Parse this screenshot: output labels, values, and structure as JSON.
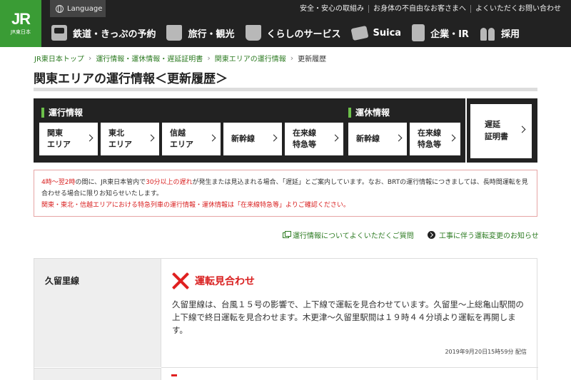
{
  "header": {
    "logo_mark": "JR",
    "logo_text": "JR東日本",
    "language_label": "Language",
    "top_links": [
      "安全・安心の取組み",
      "お身体の不自由なお客さまへ",
      "よくいただくお問い合わせ"
    ],
    "nav": [
      {
        "label": "鉄道・きっぷの予約",
        "icon": "train-icon"
      },
      {
        "label": "旅行・観光",
        "icon": "suitcase-icon"
      },
      {
        "label": "くらしのサービス",
        "icon": "shopping-bag-icon"
      },
      {
        "label": "Suica",
        "icon": "card-icon"
      },
      {
        "label": "企業・IR",
        "icon": "building-icon"
      },
      {
        "label": "採用",
        "icon": "people-icon"
      }
    ]
  },
  "breadcrumb": [
    "JR東日本トップ",
    "運行情報・運休情報・遅延証明書",
    "関東エリアの運行情報",
    "更新履歴"
  ],
  "page_title": "関東エリアの運行情報＜更新履歴＞",
  "ops_panel": {
    "operation_heading": "運行情報",
    "suspension_heading": "運休情報",
    "operation_buttons": [
      {
        "line1": "関東",
        "line2": "エリア"
      },
      {
        "line1": "東北",
        "line2": "エリア"
      },
      {
        "line1": "信越",
        "line2": "エリア"
      },
      {
        "line1": "新幹線",
        "line2": ""
      },
      {
        "line1": "在来線",
        "line2": "特急等"
      }
    ],
    "suspension_buttons": [
      {
        "line1": "新幹線",
        "line2": ""
      },
      {
        "line1": "在来線",
        "line2": "特急等"
      }
    ],
    "certificate": {
      "line1": "遅延",
      "line2": "証明書"
    }
  },
  "notice": {
    "p1_red_a": "4時～翌2時",
    "p1_a": "の間に、JR東日本管内で",
    "p1_red_b": "30分以上の遅れ",
    "p1_b": "が発生または見込まれる場合、「遅延」とご案内しています。なお、BRTの運行情報につきましては、長時間運転を見合わせる場合に限りお知らせいたします。",
    "p2": "関東・東北・信越エリアにおける特急列車の運行情報・運休情報は「在来線特急等」よりご確認ください。"
  },
  "links": {
    "faq": "運行情報についてよくいただくご質問",
    "construction": "工事に伴う運転変更のお知らせ"
  },
  "status": {
    "line_name": "久留里線",
    "status_label": "運転見合わせ",
    "detail": "久留里線は、台風１５号の影響で、上下線で運転を見合わせています。久留里～上総亀山駅間の上下線で終日運転を見合わせます。木更津～久留里駅間は１９時４４分頃より運転を再開します。",
    "timestamp": "2019年9月20日15時59分 配信"
  }
}
